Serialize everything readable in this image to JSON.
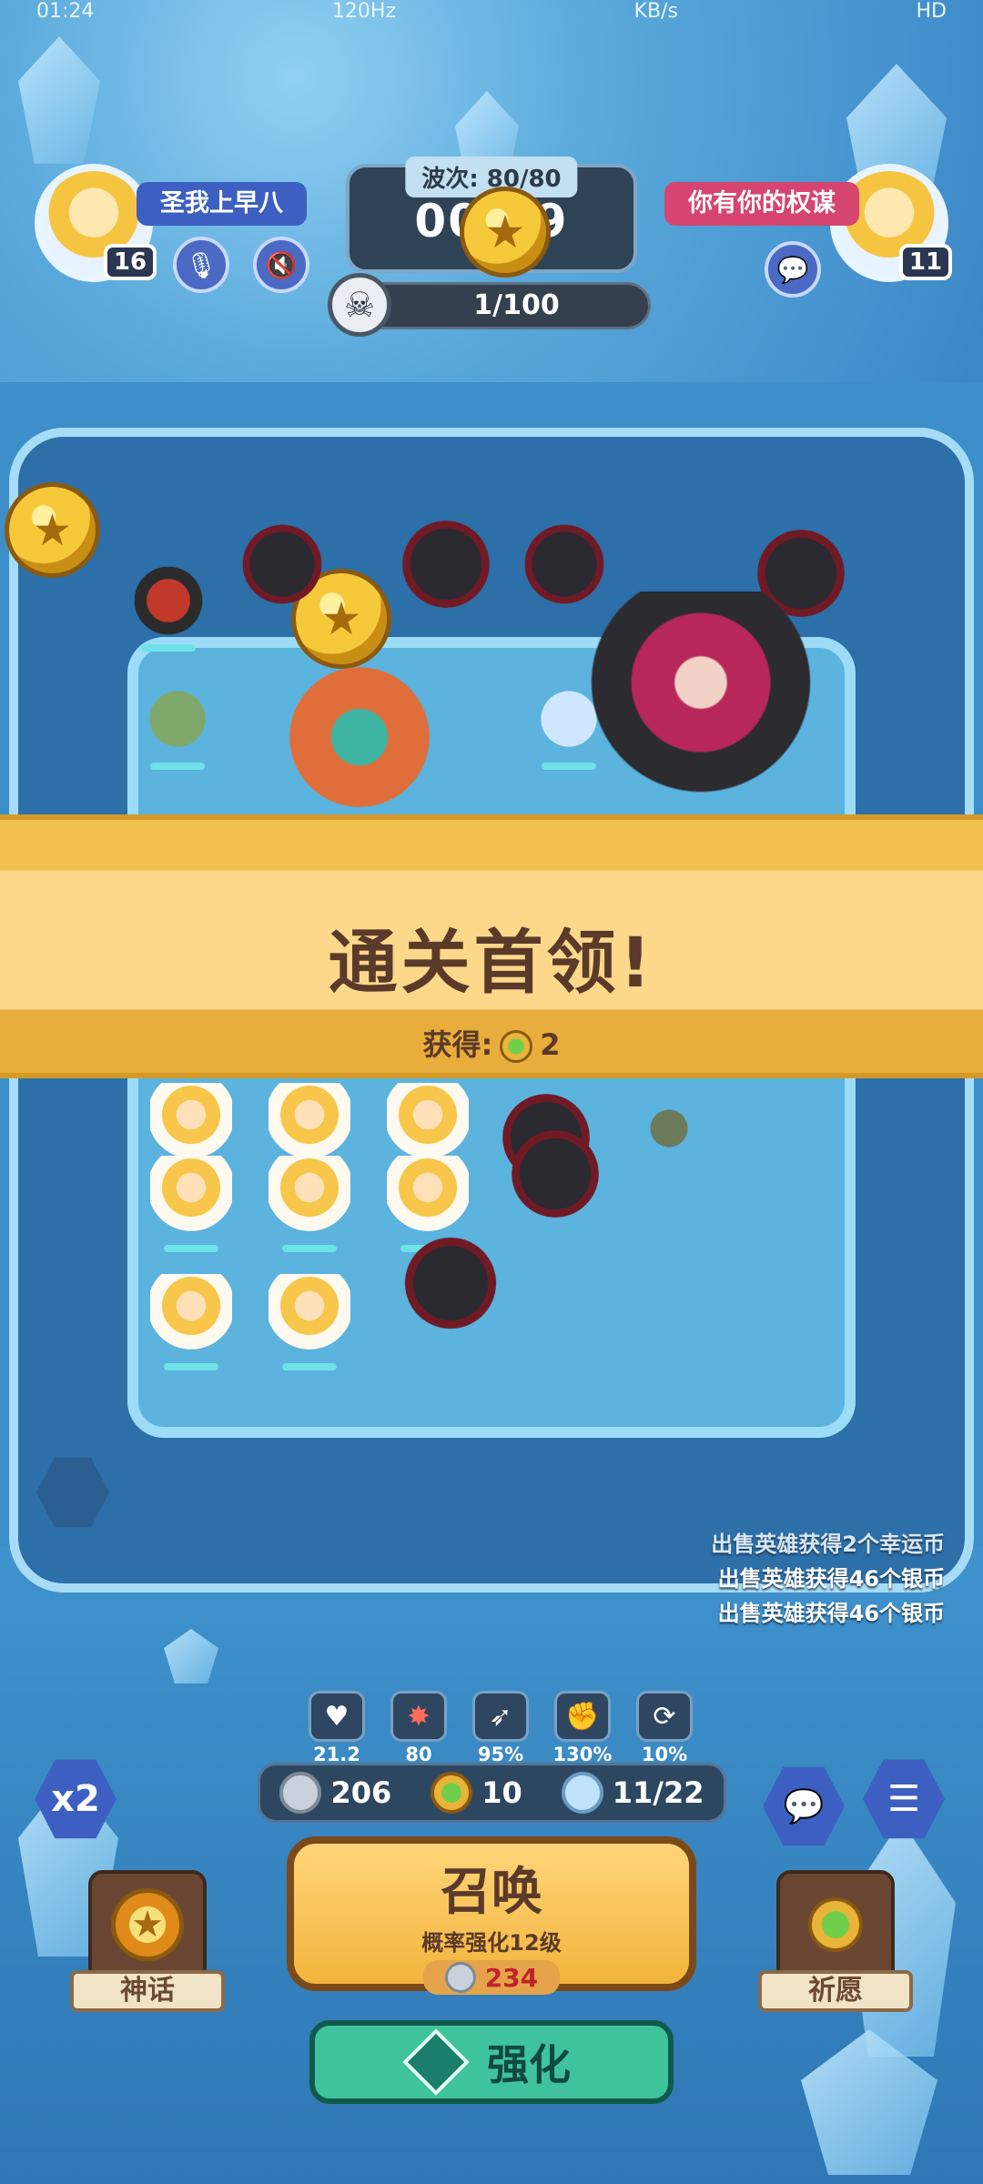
{
  "status_bar": {
    "time": "01:24",
    "refresh": "120Hz",
    "net": "KB/s",
    "hd": "HD"
  },
  "player_left": {
    "name": "圣我上早八",
    "level": "16"
  },
  "player_right": {
    "name": "你有你的权谋",
    "level": "11"
  },
  "wave": {
    "label": "波次: 80/80",
    "timer": "00:09"
  },
  "kills": {
    "value": "1/100"
  },
  "banner": {
    "title": "通关首领!",
    "reward_label": "获得:",
    "reward_value": "2"
  },
  "log": [
    "出售英雄获得2个幸运币",
    "出售英雄获得46个银币",
    "出售英雄获得46个银币"
  ],
  "stats": [
    {
      "icon": "heart-icon",
      "value": "21.2"
    },
    {
      "icon": "shield-break-icon",
      "value": "80"
    },
    {
      "icon": "bow-icon",
      "value": "95%"
    },
    {
      "icon": "fist-icon",
      "value": "130%"
    },
    {
      "icon": "speed-icon",
      "value": "10%"
    }
  ],
  "resources": {
    "silver": "206",
    "clover": "10",
    "units": "11/22"
  },
  "buttons": {
    "speed": "x2",
    "summon_title": "召唤",
    "summon_sub": "概率强化12级",
    "summon_cost": "234",
    "enhance": "强化",
    "myth": "神话",
    "wish": "祈愿"
  },
  "colors": {
    "banner": "#fbd88a",
    "enhance": "#3fc39d",
    "summon": "#f3b43c",
    "name_right": "#d6456f",
    "name_left": "#3d5fc2"
  }
}
